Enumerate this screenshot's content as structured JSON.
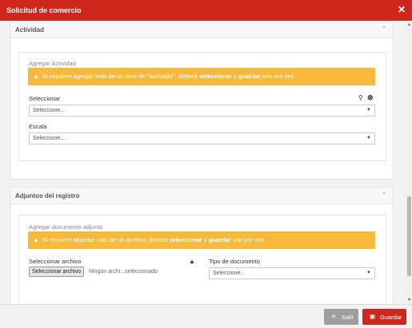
{
  "window": {
    "title": "Solicitud de comercio",
    "close_glyph": "✕"
  },
  "actividad": {
    "panel_title": "Actividad",
    "section_label": "Agregar Actividad",
    "alert": {
      "part1": "Si requiere agregar más de un ítem de \"Actividad\", deberá ",
      "bold1": "seleccionar",
      "part2": " y ",
      "bold2": "guardar",
      "part3": " uno por vez"
    },
    "select_label": "Seleccionar",
    "select_value": "Seleccione...",
    "escala_label": "Escala",
    "escala_value": "Seleccione..."
  },
  "adjuntos": {
    "panel_title": "Adjuntos del registro",
    "section_label": "Agregar documento adjunto",
    "alert": {
      "part1": "Si requiere adjuntar más de un archivo, deberá ",
      "bold1": "seleccionar",
      "part2": " y ",
      "bold2": "guardar",
      "part3": " uno por vez"
    },
    "file_label": "Seleccionar archivo",
    "file_button": "Seleccionar archivo",
    "file_status": "Ningún archi...seleccionado",
    "tipo_label": "Tipo de documento",
    "tipo_value": "Seleccione..."
  },
  "footer": {
    "salir_label": "Salir",
    "guardar_label": "Guardar"
  },
  "colors": {
    "header": "#d0271d",
    "alert": "#f6b93b",
    "salir": "#9e9e9e",
    "guardar": "#d0271d"
  }
}
